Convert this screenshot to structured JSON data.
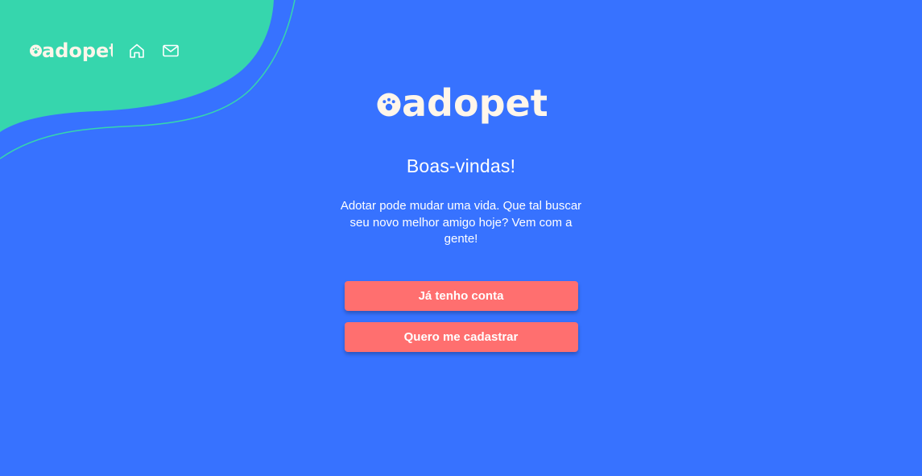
{
  "brand": {
    "name": "adopet",
    "colors": {
      "background": "#3772FF",
      "accent_shape": "#36D6AD",
      "logo": "#FFF6EA",
      "button": "#FF6F6F",
      "text": "#FFFFFF"
    }
  },
  "header": {
    "logo_text": "adopet",
    "nav": [
      {
        "icon": "home-icon",
        "label": "Home"
      },
      {
        "icon": "mail-icon",
        "label": "Mensagens"
      }
    ]
  },
  "main": {
    "logo_text": "adopet",
    "welcome_title": "Boas-vindas!",
    "intro_text": "Adotar pode mudar uma vida. Que tal buscar seu novo melhor amigo hoje? Vem com a gente!",
    "buttons": {
      "login_label": "Já tenho conta",
      "register_label": "Quero me cadastrar"
    }
  }
}
